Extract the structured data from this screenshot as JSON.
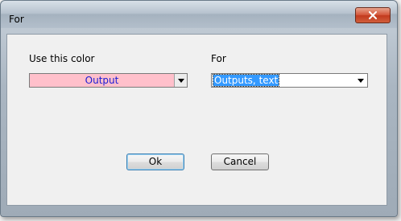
{
  "window": {
    "title": "For"
  },
  "color_section": {
    "label": "Use this color",
    "selected": "Output",
    "swatch_color": "#ffc0cb"
  },
  "for_section": {
    "label": "For",
    "selected": "Outputs, text",
    "highlight_color": "#3399ff"
  },
  "buttons": {
    "ok_label": "Ok",
    "cancel_label": "Cancel"
  }
}
